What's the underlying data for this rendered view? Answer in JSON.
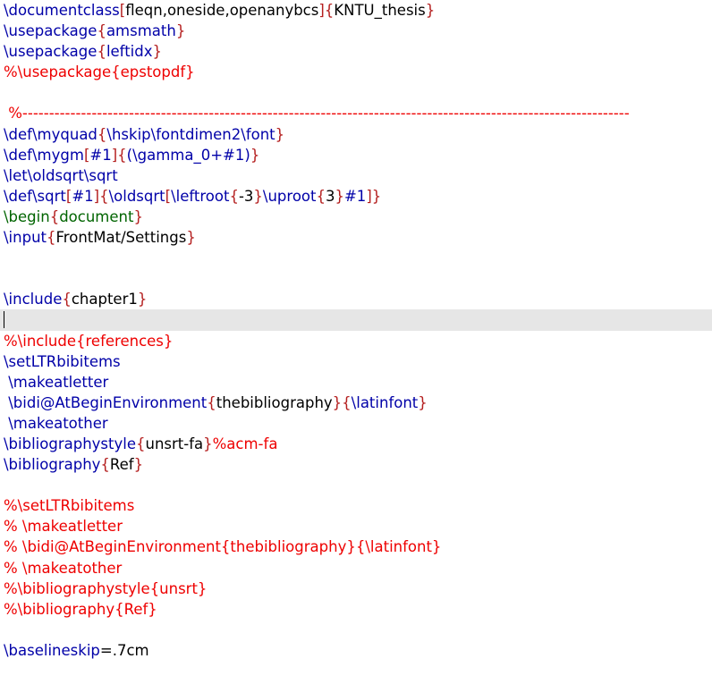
{
  "colors": {
    "command": "#0000a8",
    "brace": "#b41e1e",
    "text": "#000000",
    "comment": "#ee0000",
    "environment": "#006400",
    "current_line_highlight": "#e6e6e6"
  },
  "lines": [
    {
      "tokens": [
        {
          "t": "\\documentclass",
          "k": "cmd"
        },
        {
          "t": "[",
          "k": "brace"
        },
        {
          "t": "fleqn,oneside,openanybcs",
          "k": "text"
        },
        {
          "t": "]{",
          "k": "brace"
        },
        {
          "t": "KNTU_thesis",
          "k": "text"
        },
        {
          "t": "}",
          "k": "brace"
        }
      ]
    },
    {
      "tokens": [
        {
          "t": "\\usepackage",
          "k": "cmd"
        },
        {
          "t": "{",
          "k": "brace"
        },
        {
          "t": "amsmath",
          "k": "cmd"
        },
        {
          "t": "}",
          "k": "brace"
        }
      ]
    },
    {
      "tokens": [
        {
          "t": "\\usepackage",
          "k": "cmd"
        },
        {
          "t": "{",
          "k": "brace"
        },
        {
          "t": "leftidx",
          "k": "cmd"
        },
        {
          "t": "}",
          "k": "brace"
        }
      ]
    },
    {
      "tokens": [
        {
          "t": "%\\usepackage{epstopdf}",
          "k": "comment"
        }
      ]
    },
    {
      "tokens": []
    },
    {
      "tokens": [
        {
          "t": " %------------------------------------------------------------------------------------------------------------------",
          "k": "comment"
        }
      ]
    },
    {
      "tokens": [
        {
          "t": "\\def\\myquad",
          "k": "cmd"
        },
        {
          "t": "{",
          "k": "brace"
        },
        {
          "t": "\\hskip\\fontdimen2\\font",
          "k": "cmd"
        },
        {
          "t": "}",
          "k": "brace"
        }
      ]
    },
    {
      "tokens": [
        {
          "t": "\\def\\mygm",
          "k": "cmd"
        },
        {
          "t": "[",
          "k": "brace"
        },
        {
          "t": "#1",
          "k": "cmd"
        },
        {
          "t": "]{",
          "k": "brace"
        },
        {
          "t": "(\\gamma_0+#1)",
          "k": "cmd"
        },
        {
          "t": "}",
          "k": "brace"
        }
      ]
    },
    {
      "tokens": [
        {
          "t": "\\let\\oldsqrt\\sqrt",
          "k": "cmd"
        }
      ]
    },
    {
      "tokens": [
        {
          "t": "\\def\\sqrt",
          "k": "cmd"
        },
        {
          "t": "[",
          "k": "brace"
        },
        {
          "t": "#1",
          "k": "cmd"
        },
        {
          "t": "]{",
          "k": "brace"
        },
        {
          "t": "\\oldsqrt",
          "k": "cmd"
        },
        {
          "t": "[",
          "k": "brace"
        },
        {
          "t": "\\leftroot",
          "k": "cmd"
        },
        {
          "t": "{",
          "k": "brace"
        },
        {
          "t": "-3",
          "k": "text"
        },
        {
          "t": "}",
          "k": "brace"
        },
        {
          "t": "\\uproot",
          "k": "cmd"
        },
        {
          "t": "{",
          "k": "brace"
        },
        {
          "t": "3",
          "k": "text"
        },
        {
          "t": "}",
          "k": "brace"
        },
        {
          "t": "#1",
          "k": "cmd"
        },
        {
          "t": "]}",
          "k": "brace"
        }
      ]
    },
    {
      "tokens": [
        {
          "t": "\\begin",
          "k": "env"
        },
        {
          "t": "{",
          "k": "brace"
        },
        {
          "t": "document",
          "k": "env"
        },
        {
          "t": "}",
          "k": "brace"
        }
      ]
    },
    {
      "tokens": [
        {
          "t": "\\input",
          "k": "cmd"
        },
        {
          "t": "{",
          "k": "brace"
        },
        {
          "t": "FrontMat/Settings",
          "k": "text"
        },
        {
          "t": "}",
          "k": "brace"
        }
      ]
    },
    {
      "tokens": []
    },
    {
      "tokens": []
    },
    {
      "tokens": [
        {
          "t": "\\include",
          "k": "cmd"
        },
        {
          "t": "{",
          "k": "brace"
        },
        {
          "t": "chapter1",
          "k": "text"
        },
        {
          "t": "}",
          "k": "brace"
        }
      ]
    },
    {
      "tokens": [],
      "current": true
    },
    {
      "tokens": [
        {
          "t": "%\\include{references}",
          "k": "comment"
        }
      ]
    },
    {
      "tokens": [
        {
          "t": "\\setLTRbibitems",
          "k": "cmd"
        }
      ]
    },
    {
      "tokens": [
        {
          "t": " \\makeatletter",
          "k": "cmd"
        }
      ]
    },
    {
      "tokens": [
        {
          "t": " \\bidi@AtBeginEnvironment",
          "k": "cmd"
        },
        {
          "t": "{",
          "k": "brace"
        },
        {
          "t": "thebibliography",
          "k": "text"
        },
        {
          "t": "}{",
          "k": "brace"
        },
        {
          "t": "\\latinfont",
          "k": "cmd"
        },
        {
          "t": "}",
          "k": "brace"
        }
      ]
    },
    {
      "tokens": [
        {
          "t": " \\makeatother",
          "k": "cmd"
        }
      ]
    },
    {
      "tokens": [
        {
          "t": "\\bibliographystyle",
          "k": "cmd"
        },
        {
          "t": "{",
          "k": "brace"
        },
        {
          "t": "unsrt-fa",
          "k": "text"
        },
        {
          "t": "}",
          "k": "brace"
        },
        {
          "t": "%acm-fa",
          "k": "comment"
        }
      ]
    },
    {
      "tokens": [
        {
          "t": "\\bibliography",
          "k": "cmd"
        },
        {
          "t": "{",
          "k": "brace"
        },
        {
          "t": "Ref",
          "k": "text"
        },
        {
          "t": "}",
          "k": "brace"
        }
      ]
    },
    {
      "tokens": []
    },
    {
      "tokens": [
        {
          "t": "%\\setLTRbibitems",
          "k": "comment"
        }
      ]
    },
    {
      "tokens": [
        {
          "t": "% \\makeatletter",
          "k": "comment"
        }
      ]
    },
    {
      "tokens": [
        {
          "t": "% \\bidi@AtBeginEnvironment{thebibliography}{\\latinfont}",
          "k": "comment"
        }
      ]
    },
    {
      "tokens": [
        {
          "t": "% \\makeatother",
          "k": "comment"
        }
      ]
    },
    {
      "tokens": [
        {
          "t": "%\\bibliographystyle{unsrt}",
          "k": "comment"
        }
      ]
    },
    {
      "tokens": [
        {
          "t": "%\\bibliography{Ref}",
          "k": "comment"
        }
      ]
    },
    {
      "tokens": []
    },
    {
      "tokens": [
        {
          "t": "\\baselineskip",
          "k": "cmd"
        },
        {
          "t": "=.7cm",
          "k": "text"
        }
      ]
    }
  ]
}
